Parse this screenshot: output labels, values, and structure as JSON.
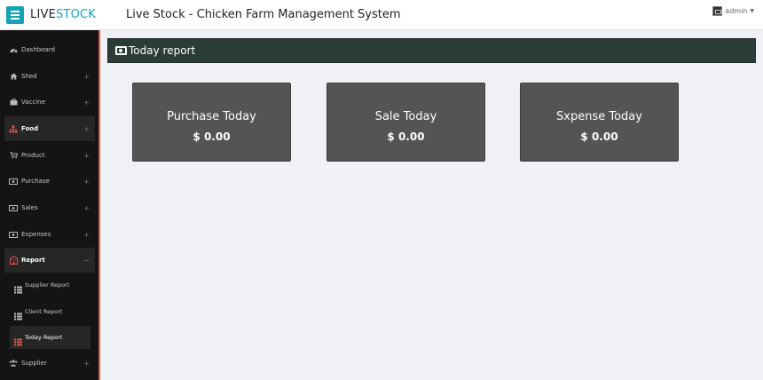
{
  "header": {
    "logo_part1": "LIVE",
    "logo_part2": "STOCK",
    "app_title": "Live Stock - Chicken Farm Management System",
    "user_name": "admin"
  },
  "sidebar": {
    "items": [
      {
        "label": "Dashboard",
        "icon": "dashboard-icon",
        "expand": ""
      },
      {
        "label": "Shed",
        "icon": "home-icon",
        "expand": "+"
      },
      {
        "label": "Vaccine",
        "icon": "briefcase-icon",
        "expand": "+"
      },
      {
        "label": "Food",
        "icon": "sitemap-icon",
        "expand": "+"
      },
      {
        "label": "Product",
        "icon": "cart-icon",
        "expand": "+"
      },
      {
        "label": "Purchase",
        "icon": "cash-icon",
        "expand": "+"
      },
      {
        "label": "Sales",
        "icon": "cash-icon",
        "expand": "+"
      },
      {
        "label": "Expenses",
        "icon": "cash-icon",
        "expand": "+"
      },
      {
        "label": "Report",
        "icon": "building-icon",
        "expand": "−"
      },
      {
        "label": "Supplier",
        "icon": "users-icon",
        "expand": "+"
      }
    ],
    "report_sub": [
      {
        "label": "Supplier Report",
        "icon": "list-icon"
      },
      {
        "label": "Client Report",
        "icon": "list-icon"
      },
      {
        "label": "Today Report",
        "icon": "list-icon"
      }
    ],
    "accent_color": "#d9534f"
  },
  "main": {
    "page_title": "Today report",
    "cards": [
      {
        "label": "Purchase Today",
        "value": "$ 0.00"
      },
      {
        "label": "Sale Today",
        "value": "$ 0.00"
      },
      {
        "label": "Sxpense Today",
        "value": "$ 0.00"
      }
    ]
  },
  "colors": {
    "brand": "#16a3b6",
    "header_bar": "#2a3b38",
    "card_bg": "#545454",
    "sidebar_bg": "#141414"
  }
}
